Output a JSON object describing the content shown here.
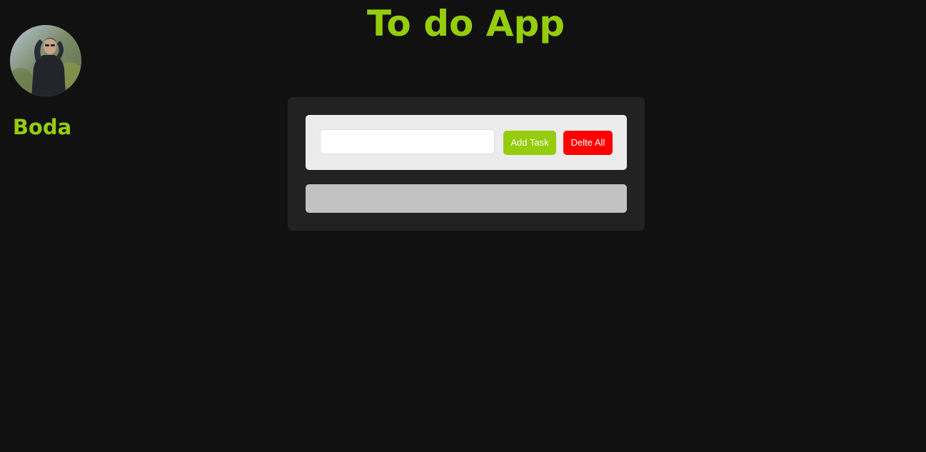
{
  "header": {
    "title": "To do App"
  },
  "profile": {
    "name": "Boda",
    "avatar_alt": "profile photo"
  },
  "form": {
    "input_value": "",
    "input_placeholder": "",
    "add_label": "Add Task",
    "delete_all_label": "Delte All"
  },
  "tasks": [],
  "colors": {
    "accent": "#95cc0c",
    "danger": "#ff0000",
    "background": "#111111",
    "container": "#222222",
    "form_background": "#ececec",
    "tasks_background": "#c2c2c2"
  }
}
